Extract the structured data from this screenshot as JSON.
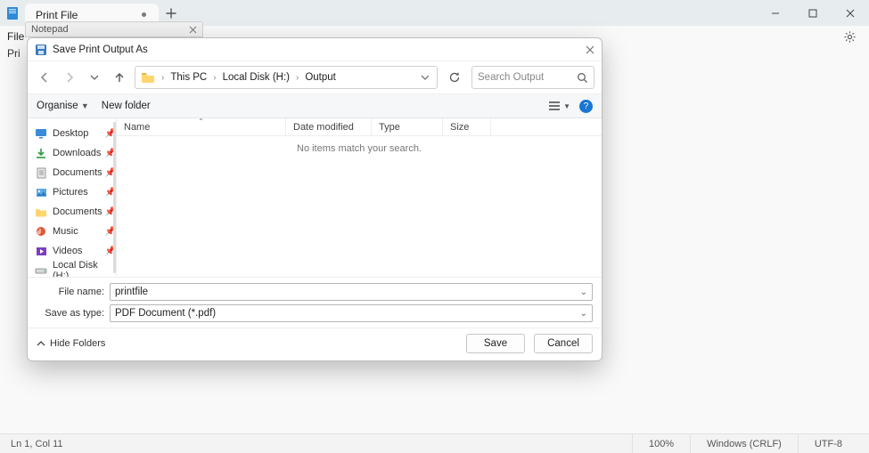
{
  "app": {
    "tab_title": "Print File",
    "menu_file": "File",
    "row3_text": "Pri",
    "secondary_tab": "Notepad"
  },
  "status": {
    "cursor": "Ln 1, Col 11",
    "zoom": "100%",
    "eol": "Windows (CRLF)",
    "encoding": "UTF-8"
  },
  "dialog": {
    "title": "Save Print Output As",
    "breadcrumb": {
      "seg1": "This PC",
      "seg2": "Local Disk (H:)",
      "seg3": "Output"
    },
    "search_placeholder": "Search Output",
    "toolbar": {
      "organise": "Organise",
      "new_folder": "New folder"
    },
    "columns": {
      "name": "Name",
      "date": "Date modified",
      "type": "Type",
      "size": "Size"
    },
    "empty": "No items match your search.",
    "sidebar": {
      "items": [
        {
          "label": "Desktop"
        },
        {
          "label": "Downloads"
        },
        {
          "label": "Documents"
        },
        {
          "label": "Pictures"
        },
        {
          "label": "Documents"
        },
        {
          "label": "Music"
        },
        {
          "label": "Videos"
        },
        {
          "label": "Local Disk (H:)"
        }
      ]
    },
    "filename_label": "File name:",
    "filename_value": "printfile",
    "savetype_label": "Save as type:",
    "savetype_value": "PDF Document (*.pdf)",
    "hide_folders": "Hide Folders",
    "save": "Save",
    "cancel": "Cancel"
  }
}
